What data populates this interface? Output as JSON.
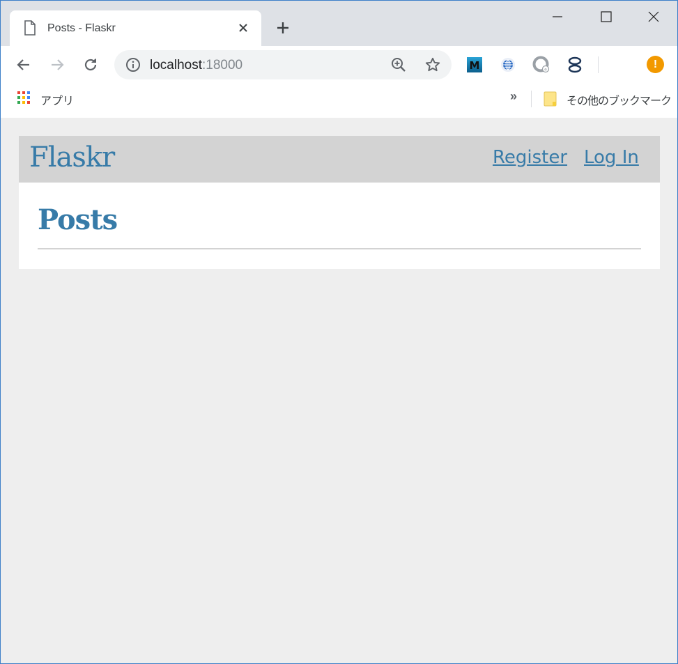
{
  "browser": {
    "tab": {
      "title": "Posts - Flaskr"
    },
    "address": {
      "host": "localhost",
      "port": ":18000"
    },
    "bookmarks": {
      "apps_label": "アプリ",
      "more": "»",
      "other_label": "その他のブックマーク"
    },
    "alert_badge": "!",
    "extensions": [
      {
        "icon": "m-extension-icon",
        "label": "M"
      }
    ]
  },
  "app": {
    "brand": "Flaskr",
    "nav": {
      "register": "Register",
      "login": "Log In"
    },
    "page_title": "Posts"
  },
  "colors": {
    "link": "#377ba8",
    "nav_bg": "#d3d3d3",
    "page_bg": "#eeeeee",
    "tabstrip_bg": "#dee1e6",
    "alert": "#f29900"
  }
}
